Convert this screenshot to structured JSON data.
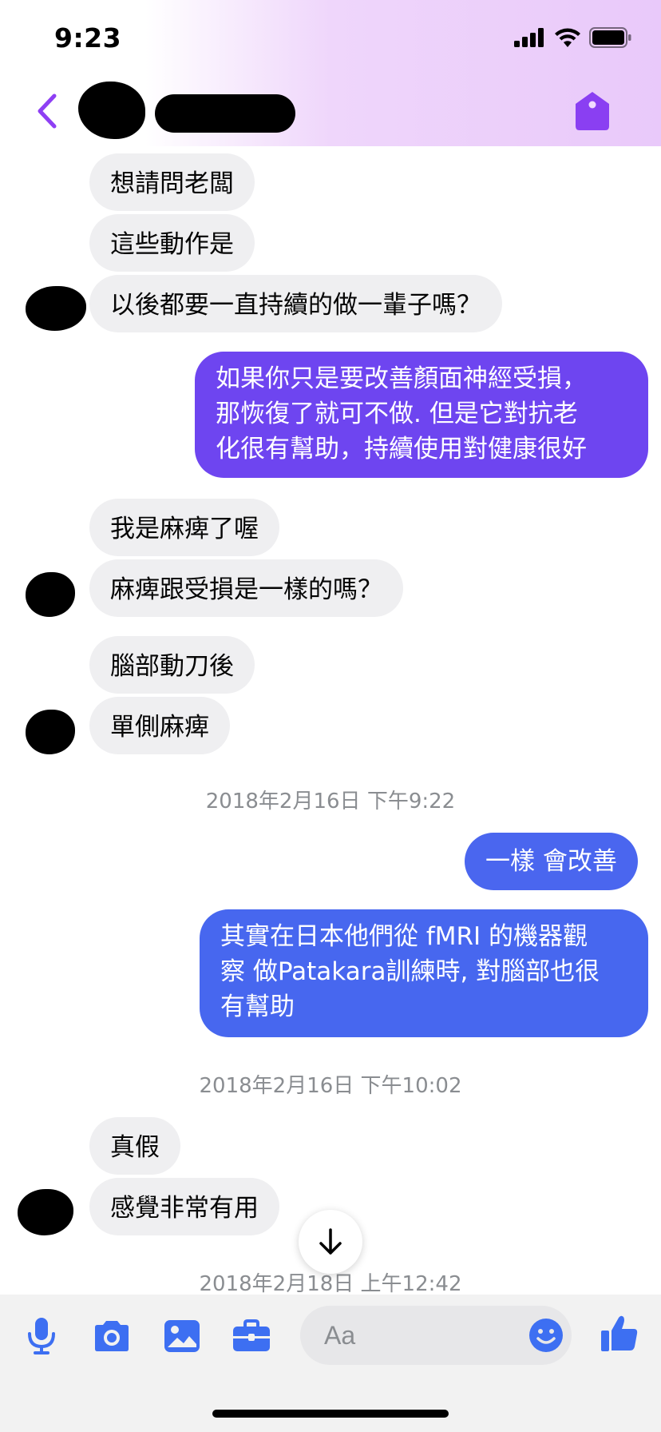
{
  "status_bar": {
    "time": "9:23"
  },
  "colors": {
    "accent": "#7f3ff3",
    "incoming_bg": "#efeff1",
    "outgoing_purple": "#6e45f0",
    "outgoing_blue": "#4767ef",
    "icon_blue": "#3d6ff2"
  },
  "header": {
    "back_icon": "chevron-left-icon",
    "action_icon": "tag-icon"
  },
  "messages": [
    {
      "text": "想請問老闆"
    },
    {
      "text": "這些動作是"
    },
    {
      "text": "以後都要一直持續的做一輩子嗎？"
    },
    {
      "text": "如果你只是要改善顏面神經受損，\n那恢復了就可不做. 但是它對抗老\n化很有幫助，持續使用對健康很好"
    },
    {
      "text": "我是麻痺了喔"
    },
    {
      "text": "麻痺跟受損是一樣的嗎？"
    },
    {
      "text": "腦部動刀後"
    },
    {
      "text": "單側麻痺"
    },
    {
      "text": "一樣 會改善"
    },
    {
      "text": "其實在日本他們從 fMRI 的機器觀\n察 做Patakara訓練時, 對腦部也很\n有幫助"
    },
    {
      "text": "真假"
    },
    {
      "text": "感覺非常有用"
    }
  ],
  "timestamps": [
    "2018年2月16日 下午9:22",
    "2018年2月16日 下午10:02",
    "2018年2月18日 上午12:42"
  ],
  "composer": {
    "placeholder": "Aa",
    "icons": [
      "microphone-icon",
      "camera-icon",
      "image-icon",
      "briefcase-icon",
      "emoji-icon",
      "thumbs-up-icon"
    ]
  }
}
